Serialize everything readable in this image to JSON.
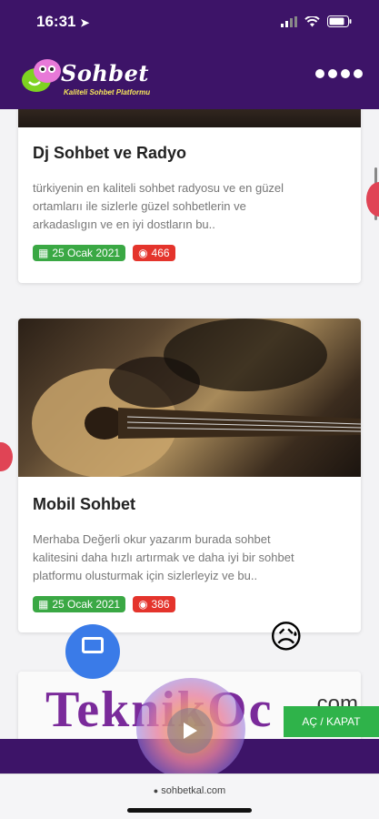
{
  "status": {
    "time": "16:31"
  },
  "header": {
    "logo_text": "Sohbet",
    "tagline": "Kaliteli Sohbet Platformu",
    "menu_icon": "more-dots-icon"
  },
  "posts": [
    {
      "title": "Dj Sohbet ve Radyo",
      "excerpt_lines": [
        "türkiyenin en kaliteli sohbet radyosu ve en güzel",
        "ortamlarıı ile sizlerle güzel sohbetlerin ve",
        "arkadaslıgın ve en iyi dostların bu.."
      ],
      "date": "25 Ocak 2021",
      "views": "466"
    },
    {
      "title": "Mobil Sohbet",
      "excerpt_lines": [
        "Merhaba Değerli okur yazarım burada sohbet",
        "kalitesini daha hızlı artırmak ve daha iyi bir sohbet",
        "platformu olusturmak için sizlerleyiz ve bu.."
      ],
      "date": "25 Ocak 2021",
      "views": "386"
    }
  ],
  "partial_card_text": "TeknikOc",
  "partial_card_text2": ".com",
  "toggle_label": "AÇ / KAPAT",
  "url": "sohbetkal.com",
  "colors": {
    "header_bg": "#3d1468",
    "badge_date": "#3aa844",
    "badge_views": "#e4342c",
    "toggle": "#2fb34a"
  }
}
